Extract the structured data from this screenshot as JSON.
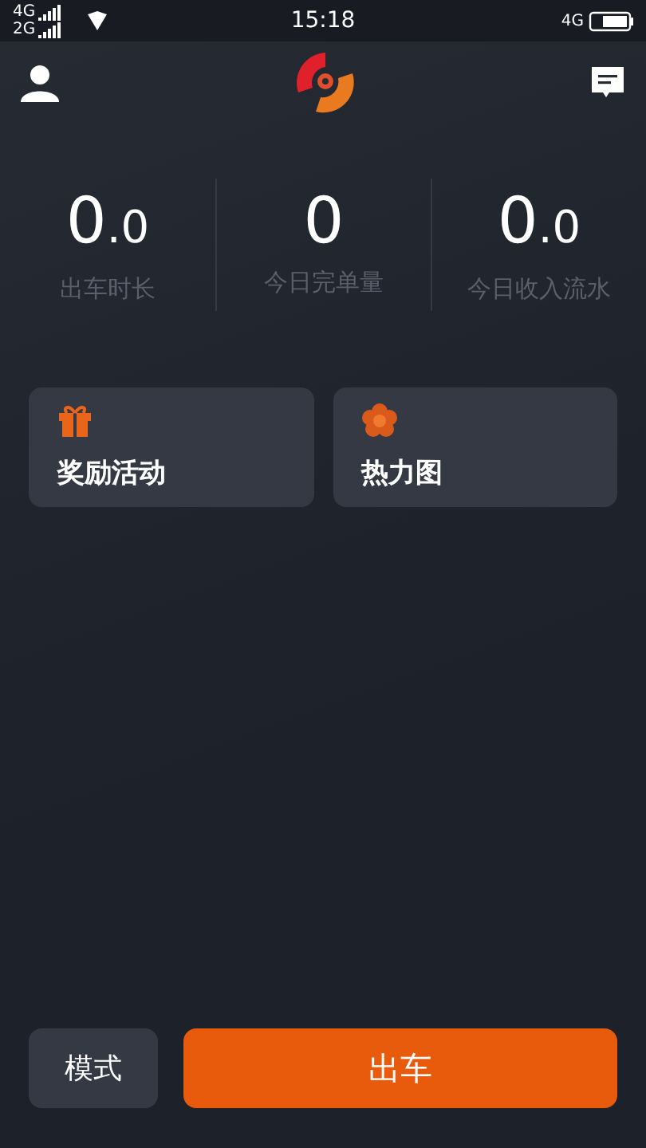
{
  "status_bar": {
    "sim1": "4G",
    "sim2": "2G",
    "time": "15:18",
    "network": "4G"
  },
  "stats": [
    {
      "whole": "0",
      "fraction": ".0",
      "label": "出车时长"
    },
    {
      "whole": "0",
      "label": "今日完单量"
    },
    {
      "whole": "0",
      "fraction": ".0",
      "label": "今日收入流水"
    }
  ],
  "cards": [
    {
      "kind": "gift",
      "label": "奖励活动"
    },
    {
      "kind": "heatmap",
      "label": "热力图"
    }
  ],
  "bottom": {
    "mode_button": "模式",
    "start_button": "出车"
  }
}
